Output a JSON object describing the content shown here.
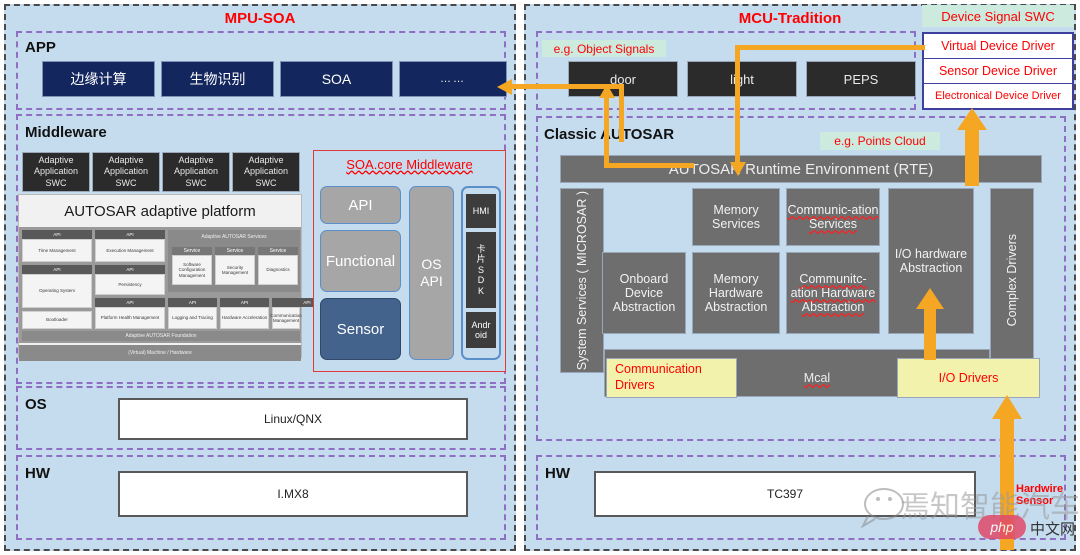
{
  "left_panel": {
    "title": "MPU-SOA",
    "app": {
      "label": "APP",
      "boxes": [
        "边缘计算",
        "生物识别",
        "SOA",
        "……"
      ]
    },
    "middleware": {
      "label": "Middleware",
      "swc_boxes": [
        "Adaptive Application SWC",
        "Adaptive Application SWC",
        "Adaptive Application SWC",
        "Adaptive Application SWC"
      ],
      "platform_title": "AUTOSAR adaptive platform",
      "services_band": "Adaptive AUTOSAR Services",
      "foundation_band": "Adaptive AUTOSAR Foundation",
      "machine_band": "(Virtual) Machine / Hardware",
      "api_label": "API",
      "service_label": "Service",
      "left_cells": [
        "Time Management",
        "Execution Management",
        "Operating System",
        "Persistency",
        "Bootloader",
        "Platform Health Management"
      ],
      "service_cells": [
        "Software Configuration Management",
        "Security Management",
        "Diagnostics"
      ],
      "bottom_cells": [
        "Logging and Tracing",
        "Hardware Acceleration",
        "Communication Management"
      ],
      "soa": {
        "title": "SOA.core Middleware",
        "stack": [
          "API",
          "Functional",
          "Sensor"
        ],
        "os_api": "OS API",
        "chips": [
          "HMI",
          "卡片SDK",
          "Android"
        ]
      }
    },
    "os": {
      "label": "OS",
      "value": "Linux/QNX"
    },
    "hw": {
      "label": "HW",
      "value": "I.MX8"
    }
  },
  "right_panel": {
    "title": "MCU-Tradition",
    "object_signals": {
      "label": "e.g. Object Signals",
      "boxes": [
        "door",
        "light",
        "PEPS"
      ]
    },
    "device_signal": {
      "title": "Device Signal SWC",
      "rows": [
        "Virtual Device Driver",
        "Sensor Device Driver",
        "Electronical Device Driver"
      ]
    },
    "classic": {
      "label": "Classic AUTOSAR",
      "points_cloud": "e.g. Points Cloud",
      "rte": "AUTOSAR Runtime Environment  (RTE)",
      "system_services": "System Services ( MICROSAR )",
      "complex_drivers": "Complex Drivers",
      "row_top": [
        "Memory Services",
        "Communic-ation Services"
      ],
      "row_mid": [
        "Onboard Device Abstraction",
        "Memory Hardware Abstraction",
        "Communitc-ation Hardware Abstraction"
      ],
      "io_hw_abstraction": "I/O hardware Abstraction",
      "drivers": [
        "Communication Drivers",
        "Mcal",
        "I/O Drivers"
      ]
    },
    "hw": {
      "label": "HW",
      "value": "TC397"
    },
    "hardwire_sensor": "Hardwire Sensor"
  },
  "watermark": {
    "text": "焉知智能汽车",
    "badge": "php",
    "suffix": "中文网"
  },
  "colors": {
    "accent_red": "#ff0000",
    "panel_bg": "#c5dcef",
    "navy": "#14265e",
    "arrow": "#f5a623",
    "gray_box": "#6e6e6e",
    "yellow_box": "#f2f2ad"
  }
}
